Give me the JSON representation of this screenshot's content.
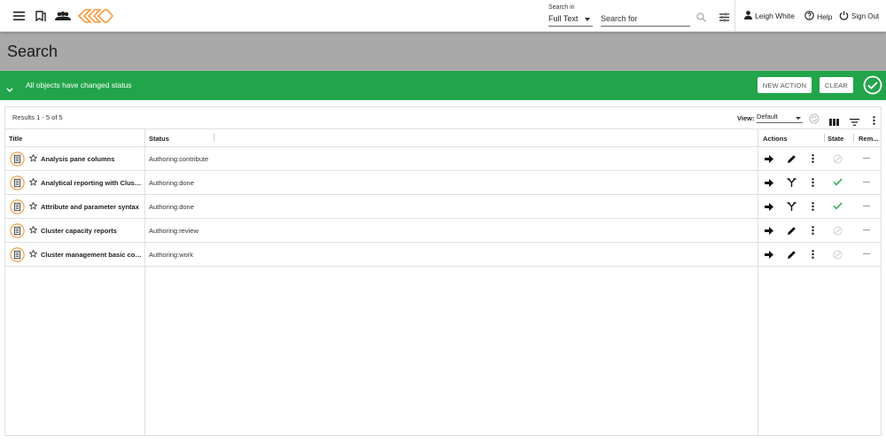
{
  "header": {
    "search_in_label": "Search in",
    "search_in_value": "Full Text",
    "search_placeholder": "Search for",
    "user_name": "Leigh White",
    "help_label": "Help",
    "signout_label": "Sign Out"
  },
  "page": {
    "title": "Search"
  },
  "banner": {
    "message": "All objects have changed status",
    "new_action_label": "NEW ACTION",
    "clear_label": "CLEAR",
    "color": "#22a54a"
  },
  "results": {
    "count_text": "Results 1 - 5 of 5",
    "view_label": "View:",
    "view_value": "Default",
    "columns": {
      "title": "Title",
      "status": "Status",
      "actions": "Actions",
      "state": "State",
      "remove": "Rem..."
    },
    "rows": [
      {
        "title": "Analysis pane columns",
        "status": "Authoring:contribute",
        "action2_icon": "pencil-icon",
        "state_icon": "disabled-icon"
      },
      {
        "title": "Analytical reporting with Cluster...",
        "status": "Authoring:done",
        "action2_icon": "merge-icon",
        "state_icon": "check-icon"
      },
      {
        "title": "Attribute and parameter syntax",
        "status": "Authoring:done",
        "action2_icon": "merge-icon",
        "state_icon": "check-icon"
      },
      {
        "title": "Cluster capacity reports",
        "status": "Authoring:review",
        "action2_icon": "pencil-icon",
        "state_icon": "disabled-icon"
      },
      {
        "title": "Cluster management basic com...",
        "status": "Authoring:work",
        "action2_icon": "pencil-icon",
        "state_icon": "disabled-icon"
      }
    ]
  },
  "colors": {
    "accent_orange": "#f39c3c",
    "success_green": "#22a54a",
    "title_band": "#a9a9a9"
  }
}
